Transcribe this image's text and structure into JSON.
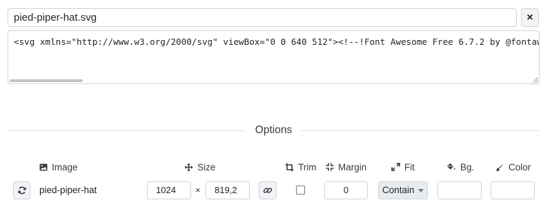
{
  "file": {
    "name": "pied-piper-hat.svg",
    "close_label": "×",
    "svg_source": "<svg xmlns=\"http://www.w3.org/2000/svg\" viewBox=\"0 0 640 512\"><!--!Font Awesome Free 6.7.2 by @fontawesome"
  },
  "options": {
    "title": "Options",
    "headers": {
      "image": "Image",
      "size": "Size",
      "trim": "Trim",
      "margin": "Margin",
      "fit": "Fit",
      "bg": "Bg.",
      "color": "Color"
    },
    "row": {
      "image_name": "pied-piper-hat",
      "width": "1024",
      "times": "×",
      "height": "819,2",
      "trim_checked": false,
      "margin": "0",
      "fit": "Contain",
      "bg": "",
      "color": ""
    }
  },
  "icons": {
    "image_header": "image-icon",
    "size_header": "arrows-move-icon",
    "trim_header": "crop-icon",
    "margin_header": "compress-icon",
    "fit_header": "expand-arrows-icon",
    "bg_header": "paint-bucket-icon",
    "color_header": "paintbrush-icon",
    "refresh": "refresh-icon",
    "link": "link-icon"
  }
}
